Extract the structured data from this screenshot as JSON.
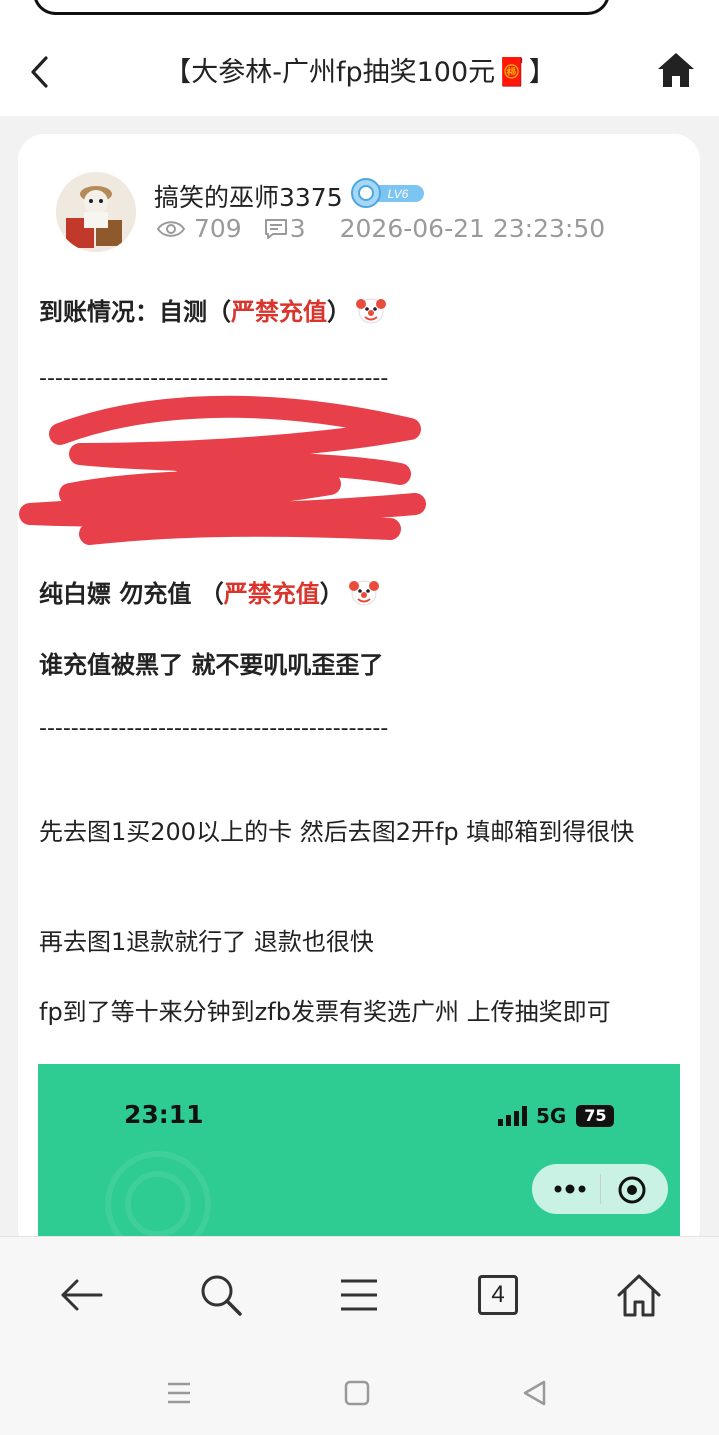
{
  "header": {
    "title": "【大参林-广州fp抽奖100元🧧】",
    "back_icon": "chevron-left-icon",
    "home_icon": "home-icon"
  },
  "post": {
    "author": "搞笑的巫师3375",
    "level": "LV6",
    "views": "709",
    "comments": "3",
    "datetime": "2026-06-21 23:23:50",
    "line1_prefix": "到账情况：自测（",
    "line1_red": "严禁充值",
    "line1_suffix": "）",
    "divider": "--------------------------------------------",
    "line3_prefix": "纯白嫖 勿充值 （",
    "line3_red": "严禁充值",
    "line3_suffix": "）",
    "line4": "谁充值被黑了 就不要叽叽歪歪了",
    "para1": "先去图1买200以上的卡 然后去图2开fp 填邮箱到得很快",
    "para2": "再去图1退款就行了 退款也很快",
    "para3": "fp到了等十来分钟到zfb发票有奖选广州 上传抽奖即可",
    "emoji": "clown-face-icon"
  },
  "screenshot_preview": {
    "time": "23:11",
    "network": "5G",
    "battery": "75",
    "bg_color": "#2ecb92"
  },
  "bottom_nav": {
    "tab_count": "4",
    "icons": [
      "back-arrow-icon",
      "search-icon",
      "menu-icon",
      "tabs-icon",
      "home-icon"
    ]
  },
  "colors": {
    "accent_red": "#d9352c",
    "scribble_red": "#e8404a"
  }
}
